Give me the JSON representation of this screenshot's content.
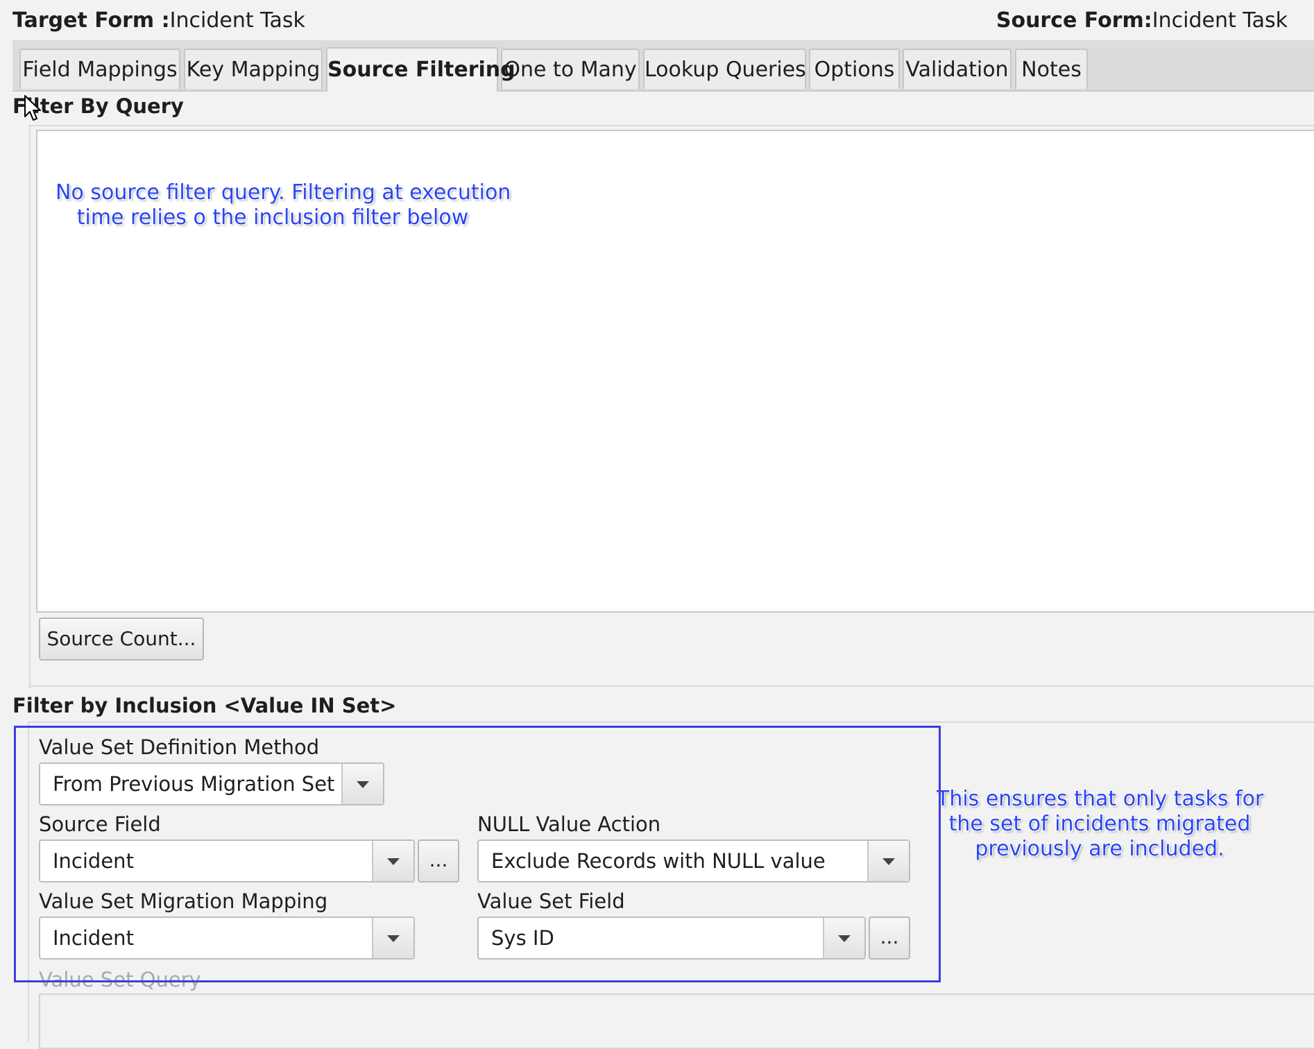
{
  "header": {
    "target_label": "Target Form :",
    "target_value": "Incident Task",
    "source_label": "Source Form:",
    "source_value": "Incident Task"
  },
  "tabs": [
    {
      "label": "Field Mappings",
      "active": false
    },
    {
      "label": "Key Mapping",
      "active": false
    },
    {
      "label": "Source Filtering",
      "active": true
    },
    {
      "label": "One to Many",
      "active": false
    },
    {
      "label": "Lookup Queries",
      "active": false
    },
    {
      "label": "Options",
      "active": false
    },
    {
      "label": "Validation",
      "active": false
    },
    {
      "label": "Notes",
      "active": false
    }
  ],
  "filter_by_query": {
    "title": "Filter By Query",
    "query_text": "",
    "source_count_button": "Source Count..."
  },
  "annotations": {
    "query_note_line1": "No source filter query. Filtering at execution",
    "query_note_line2": "time relies o the inclusion filter below",
    "inclusion_note_line1": "This ensures that only tasks for",
    "inclusion_note_line2": "the set of incidents migrated",
    "inclusion_note_line3": "previously are included.",
    "highlight_color": "#3b3ee0",
    "text_color": "#2a44f2"
  },
  "filter_by_inclusion": {
    "title": "Filter by Inclusion <Value IN Set>",
    "value_set_definition_method": {
      "label": "Value Set Definition Method",
      "value": "From Previous Migration Set"
    },
    "source_field": {
      "label": "Source Field",
      "value": "Incident",
      "ellipsis": "..."
    },
    "null_value_action": {
      "label": "NULL Value Action",
      "value": "Exclude Records with NULL value"
    },
    "value_set_migration_mapping": {
      "label": "Value Set Migration Mapping",
      "value": "Incident"
    },
    "value_set_field": {
      "label": "Value Set Field",
      "value": "Sys ID",
      "ellipsis": "..."
    },
    "value_set_query": {
      "label": "Value Set Query",
      "value": ""
    }
  }
}
